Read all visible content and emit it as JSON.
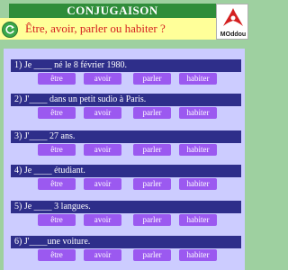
{
  "header": {
    "title": "CONJUGAISON",
    "logo_text": "MOddou"
  },
  "prompt": {
    "question": "Être, avoir, parler ou habiter ?"
  },
  "questions": [
    {
      "text": "1) Je ____ né le 8 février 1980.",
      "options": [
        "être",
        "avoir",
        "parler",
        "habiter"
      ]
    },
    {
      "text": "2) J'____ dans un petit sudio à Paris.",
      "options": [
        "être",
        "avoir",
        "parler",
        "habiter"
      ]
    },
    {
      "text": "3) J'____ 27 ans.",
      "options": [
        "être",
        "avoir",
        "parler",
        "habiter"
      ]
    },
    {
      "text": "4) Je ____ étudiant.",
      "options": [
        "être",
        "avoir",
        "parler",
        "habiter"
      ]
    },
    {
      "text": "5) Je ____ 3 langues.",
      "options": [
        "être",
        "avoir",
        "parler",
        "habiter"
      ]
    },
    {
      "text": "6) J'____une voiture.",
      "options": [
        "être",
        "avoir",
        "parler",
        "habiter"
      ]
    }
  ],
  "colors": {
    "background": "#9ed0a0",
    "title_bar": "#2f8d3a",
    "question_bar": "#ffff99",
    "question_text": "#d42020",
    "panel": "#ccccff",
    "row_label": "#2e2e8a",
    "option_button": "#9b59f0"
  },
  "icons": {
    "refresh": "refresh-icon",
    "logo": "pdf-logo-icon"
  }
}
